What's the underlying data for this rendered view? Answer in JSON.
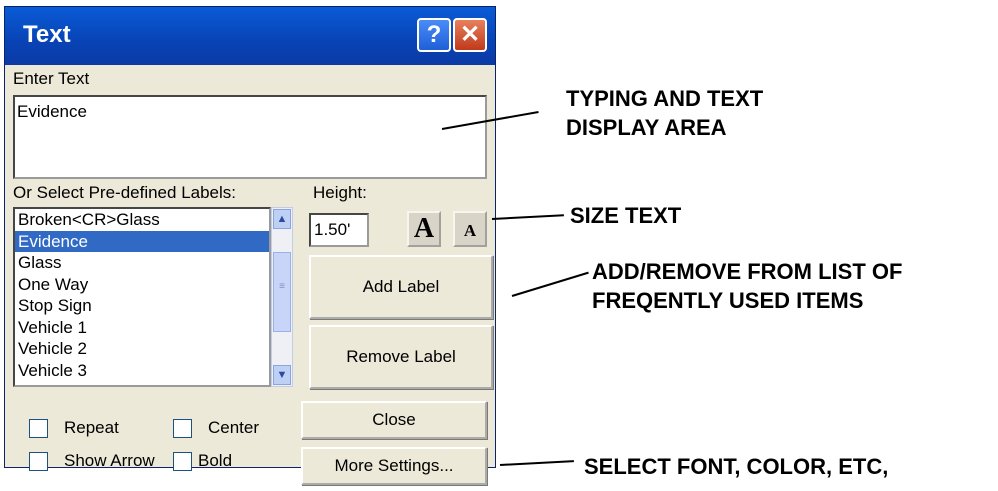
{
  "dialog": {
    "title": "Text",
    "help_button": "?",
    "close_button": "✕",
    "enter_text_label": "Enter Text",
    "text_value": "Evidence",
    "predefined_label": "Or Select Pre-defined Labels:",
    "height_label": "Height:",
    "height_value": "1.50'",
    "grow_icon": "A",
    "shrink_icon": "A",
    "labels": [
      "Broken<CR>Glass",
      "Evidence",
      "Glass",
      "One Way",
      "Stop Sign",
      "Vehicle 1",
      "Vehicle 2",
      "Vehicle 3"
    ],
    "selected_label": "Evidence",
    "add_label": "Add Label",
    "remove_label": "Remove Label",
    "repeat": "Repeat",
    "center": "Center",
    "show_arrow": "Show Arrow",
    "bold": "Bold",
    "close": "Close",
    "more_settings": "More Settings..."
  },
  "annotations": {
    "typing_1": "TYPING AND TEXT",
    "typing_2": "DISPLAY AREA",
    "size": "SIZE TEXT",
    "addremove_1": "ADD/REMOVE FROM LIST OF",
    "addremove_2": "FREQENTLY USED ITEMS",
    "font": "SELECT FONT, COLOR, ETC,"
  }
}
